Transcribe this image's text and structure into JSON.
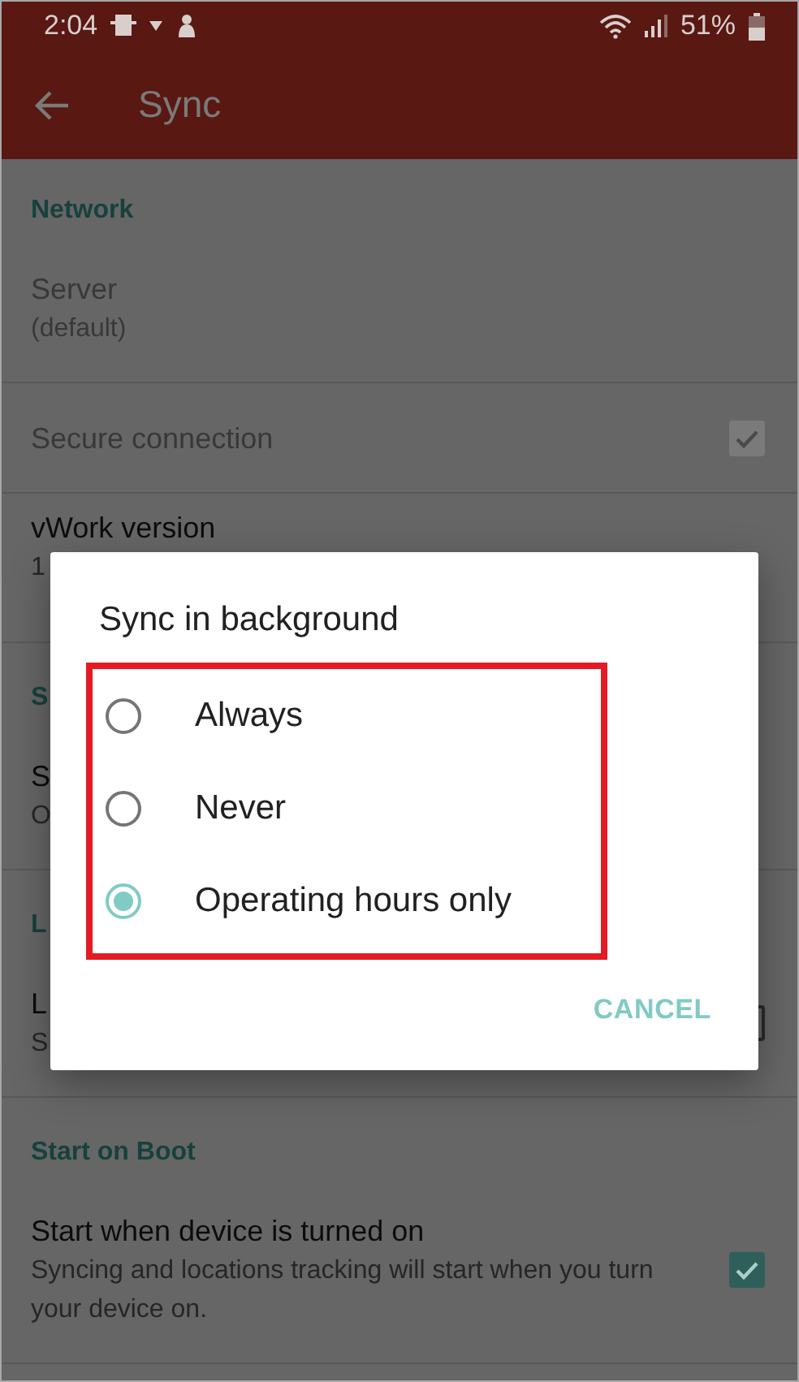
{
  "status_bar": {
    "time": "2:04",
    "battery": "51%"
  },
  "app_bar": {
    "title": "Sync"
  },
  "sections": [
    {
      "header": "Network",
      "items": [
        {
          "kind": "text",
          "title": "Server",
          "subtitle": "(default)",
          "disabled": true
        },
        {
          "kind": "checkbox",
          "title": "Secure connection",
          "checked": true,
          "disabled": true
        },
        {
          "kind": "text",
          "title": "vWork version",
          "subtitle": "1",
          "disabled": false
        }
      ]
    },
    {
      "header": "S",
      "items": [
        {
          "kind": "text",
          "title": "S",
          "subtitle": "O",
          "disabled": false
        }
      ]
    },
    {
      "header": "L",
      "items": [
        {
          "kind": "checkbox",
          "title": "L",
          "subtitle": "S",
          "checked": false,
          "disabled": false
        }
      ]
    },
    {
      "header": "Start on Boot",
      "items": [
        {
          "kind": "checkbox",
          "title": "Start when device is turned on",
          "subtitle": "Syncing and locations tracking will start when you turn your device on.",
          "checked": true,
          "disabled": false
        }
      ]
    }
  ],
  "dialog": {
    "title": "Sync in background",
    "options": [
      {
        "label": "Always",
        "selected": false
      },
      {
        "label": "Never",
        "selected": false
      },
      {
        "label": "Operating hours only",
        "selected": true
      }
    ],
    "button": "CANCEL"
  }
}
